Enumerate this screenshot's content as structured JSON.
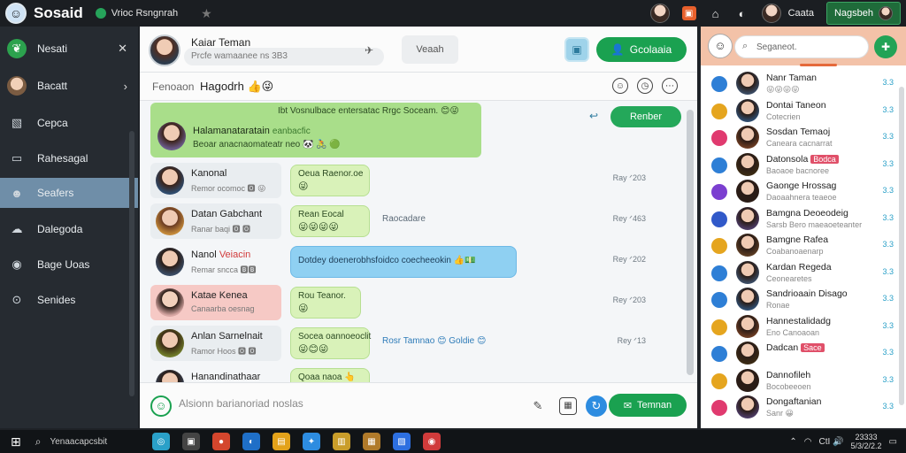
{
  "app": {
    "logo_glyph": "☺",
    "title": "Sosaid"
  },
  "topbar": {
    "status_text": "Vrioc Rsngnrah",
    "user_name": "Caata",
    "button_label": "Nagsbeh"
  },
  "sidebar": {
    "items": [
      {
        "label": "Nesati",
        "icon": "leaf-icon",
        "action": "✕"
      },
      {
        "label": "Bacatt",
        "icon": "avatar",
        "action": "›"
      },
      {
        "label": "Cepca",
        "icon": "image-icon",
        "action": ""
      },
      {
        "label": "Rahesagal",
        "icon": "chat-icon",
        "action": ""
      },
      {
        "label": "Seafers",
        "icon": "people-icon",
        "action": ""
      },
      {
        "label": "Dalegoda",
        "icon": "cloud-icon",
        "action": ""
      },
      {
        "label": "Bage Uoas",
        "icon": "eye-icon",
        "action": ""
      },
      {
        "label": "Senides",
        "icon": "coin-icon",
        "action": ""
      }
    ]
  },
  "chat": {
    "header": {
      "name": "Kaiar Teman",
      "subtitle": "Prcfe wamaanee ns 3B3",
      "search_label": "Veaah",
      "button_label": "Gcolaaia"
    },
    "subheader": {
      "left": "Fenoaon",
      "title": "Hagodrh 👍😜"
    },
    "pinned": {
      "top_text": "Ibt Vosnulbace entersatac Rrgc Soceam. 😊😜",
      "name": "Halamanataratain",
      "name_tag": "eanbacfic",
      "text": "Beoar anacnaomateatr neo 🐼 🚴 🟢"
    },
    "reply_label": "Renber",
    "messages": [
      {
        "name": "Kanonal",
        "tag": "",
        "sub": "Remor ocomoc 🅾 😜",
        "bubble": "Oeua Raenor.oe",
        "emoji": "😜",
        "note": "",
        "time": "Ray ᐟ203"
      },
      {
        "name": "Datan Gabchant",
        "tag": "",
        "sub": "Ranar baqi 🅾 🅾",
        "bubble": "Rean Eocal",
        "emoji": "😜😜😜😜",
        "note": "Raocadare",
        "time": "Rey ᐟ463"
      },
      {
        "name": "Nanol",
        "tag": "Veiacin",
        "sub": "Remar sncca 🅱🅱",
        "bubble": "Dotdey doenerobhsfoidco coecheeokin 👍💵",
        "emoji": "",
        "note": "",
        "time": "Rey ᐟ202"
      },
      {
        "name": "Katae Kenea",
        "tag": "",
        "sub": "Canaarba oesnag",
        "bubble": "Rou Teanor.",
        "emoji": "😜",
        "note": "",
        "time": "Rey ᐟ203"
      },
      {
        "name": "Anlan Sarnelnait",
        "tag": "",
        "sub": "Ramor Hoos 🅾 🅾",
        "bubble": "Socea oannoeoclit",
        "emoji": "😜😊😜",
        "note": "Rosr Tamnao 😊 Goldie 😊",
        "time": "Rey ᐟ13"
      },
      {
        "name": "Hanandinathaar",
        "tag": "",
        "sub": "",
        "bubble": "Qoaa naoa 👆",
        "emoji": "",
        "note": "",
        "time": ""
      }
    ],
    "composer": {
      "placeholder": "Alsionn barianoriad noslas",
      "send_label": "Temnan"
    }
  },
  "right": {
    "search_placeholder": "Seganeot.",
    "contacts": [
      {
        "name": "Nanr Taman",
        "tag": "",
        "status": "😜😜😜😜",
        "time": "3.3",
        "dot": "#2e7fd6"
      },
      {
        "name": "Dontai Taneon",
        "tag": "",
        "status": "Cotecrien",
        "time": "3.3",
        "dot": "#e5a51f"
      },
      {
        "name": "Sosdan Temaoj",
        "tag": "",
        "status": "Caneara cacnarrat",
        "time": "3.3",
        "dot": "#e03a6f"
      },
      {
        "name": "Datonsola",
        "tag": "Bodca",
        "status": "Baoaoe bacnoree",
        "time": "3.3",
        "dot": "#2e7fd6"
      },
      {
        "name": "Gaonge Hrossag",
        "tag": "",
        "status": "Daoaahnera teaeoe",
        "time": "3.3",
        "dot": "#7b3fd0"
      },
      {
        "name": "Bamgna Deoeodeig",
        "tag": "",
        "status": "Sarsb Bero maeaoeteanter",
        "time": "3.3",
        "dot": "#3159c9"
      },
      {
        "name": "Bamgne Rafea",
        "tag": "",
        "status": "Coabanoaenarp",
        "time": "3.3",
        "dot": "#e5a51f"
      },
      {
        "name": "Kardan Regeda",
        "tag": "",
        "status": "Ceonearetes",
        "time": "3.3",
        "dot": "#2e7fd6"
      },
      {
        "name": "Sandrioaain Disago",
        "tag": "",
        "status": "Ronae",
        "time": "3.3",
        "dot": "#2e7fd6"
      },
      {
        "name": "Hannestalidadg",
        "tag": "",
        "status": "Eno Canoaoan",
        "time": "3.3",
        "dot": "#e5a51f"
      },
      {
        "name": "Dadcan",
        "tag": "Sace",
        "status": "",
        "time": "3.3",
        "dot": "#2e7fd6"
      },
      {
        "name": "Dannofileh",
        "tag": "",
        "status": "Bocobeeoen",
        "time": "3.3",
        "dot": "#e5a51f"
      },
      {
        "name": "Dongaftanian",
        "tag": "",
        "status": "Sanr 😀",
        "time": "3.3",
        "dot": "#e03a6f"
      }
    ]
  },
  "taskbar": {
    "search_text": "Yenaacapcsbit",
    "tray_text": "CtI 🔊",
    "clock_time": "23333",
    "clock_date": "5/3/2/2.2"
  }
}
